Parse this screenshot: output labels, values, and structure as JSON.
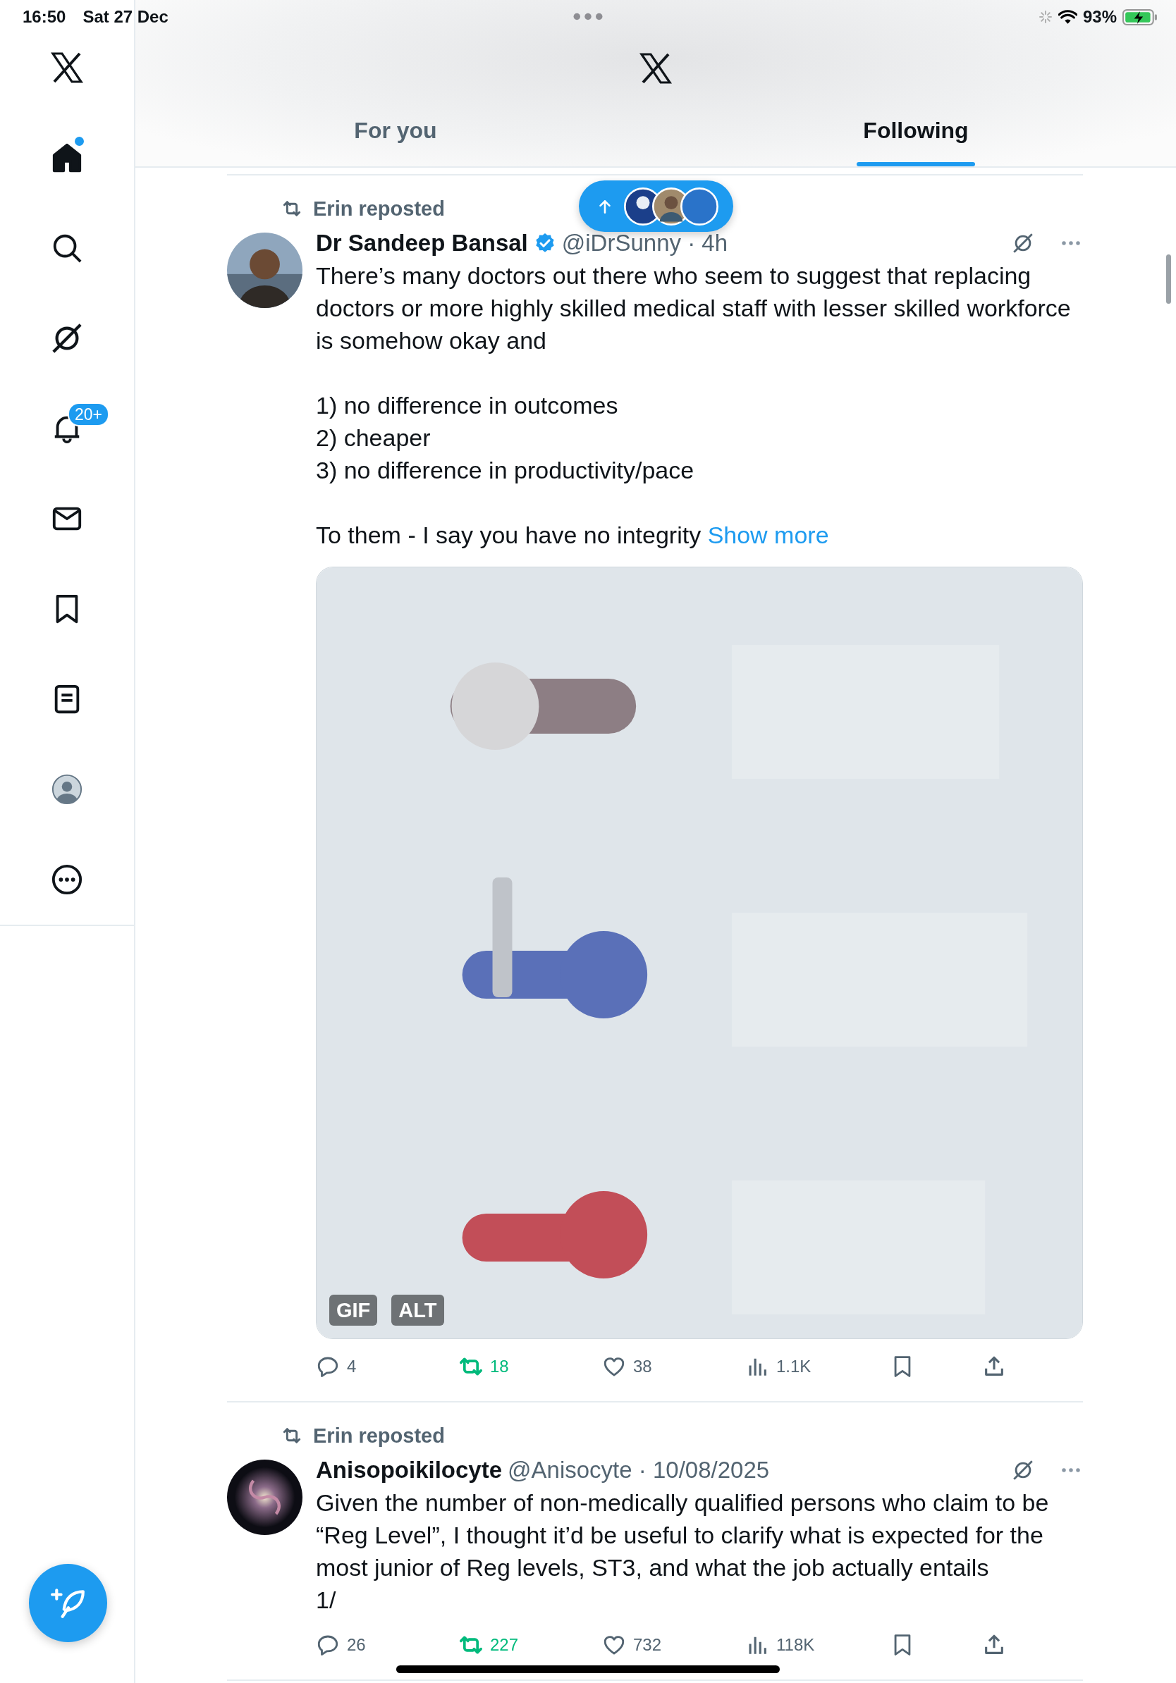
{
  "status_bar": {
    "time": "16:50",
    "date": "Sat 27 Dec",
    "battery": "93%"
  },
  "sidebar": {
    "items": [
      {
        "kind": "home",
        "selected": true,
        "unread": true
      },
      {
        "kind": "search",
        "selected": false,
        "unread": false
      },
      {
        "kind": "grok",
        "selected": false,
        "unread": false
      },
      {
        "kind": "notifications",
        "selected": false,
        "unread": false,
        "badge": "20+"
      },
      {
        "kind": "messages",
        "selected": false,
        "unread": false
      },
      {
        "kind": "bookmarks",
        "selected": false,
        "unread": false
      },
      {
        "kind": "lists",
        "selected": false,
        "unread": false
      },
      {
        "kind": "profile",
        "selected": false,
        "unread": false
      },
      {
        "kind": "more",
        "selected": false,
        "unread": false
      }
    ]
  },
  "tabs": [
    {
      "label": "For you",
      "selected": false
    },
    {
      "label": "Following",
      "selected": true
    }
  ],
  "tweets": [
    {
      "repost_label": "Erin reposted",
      "name": "Dr Sandeep Bansal",
      "verified": true,
      "meta": "@iDrSunny · 4h",
      "paragraphs": [
        "There’s many doctors out there who seem to suggest that replacing\ndoctors or more highly skilled medical staff with lesser skilled workforce\nis somehow okay and",
        "1) no difference in outcomes\n2) cheaper\n3) no difference in productivity/pace",
        "To them - I say you have no integrity"
      ],
      "show_more": "Show more",
      "media": {
        "kind": "picture",
        "badges": [
          "GIF",
          "ALT"
        ]
      },
      "actions": [
        {
          "kind": "reply",
          "count": "4"
        },
        {
          "kind": "repost",
          "count": "18",
          "active": true
        },
        {
          "kind": "like",
          "count": "38",
          "active": false
        },
        {
          "kind": "views",
          "count": "1.1K"
        },
        {
          "kind": "bookmark",
          "active": false
        },
        {
          "kind": "share"
        }
      ]
    },
    {
      "repost_label": "Erin reposted",
      "name": "Anisopoikilocyte",
      "verified": false,
      "meta": "@Anisocyte · 10/08/2025",
      "paragraphs": [
        "Given the number of non-medically qualified persons who claim to be\n“Reg Level”, I thought it’d be useful to clarify what is expected for the\nmost junior of Reg levels, ST3, and what the job actually entails\n1/"
      ],
      "actions": [
        {
          "kind": "reply",
          "count": "26"
        },
        {
          "kind": "repost",
          "count": "227",
          "active": true
        },
        {
          "kind": "like",
          "count": "732",
          "active": false
        },
        {
          "kind": "views",
          "count": "118K"
        },
        {
          "kind": "bookmark",
          "active": false
        },
        {
          "kind": "share"
        }
      ]
    }
  ]
}
